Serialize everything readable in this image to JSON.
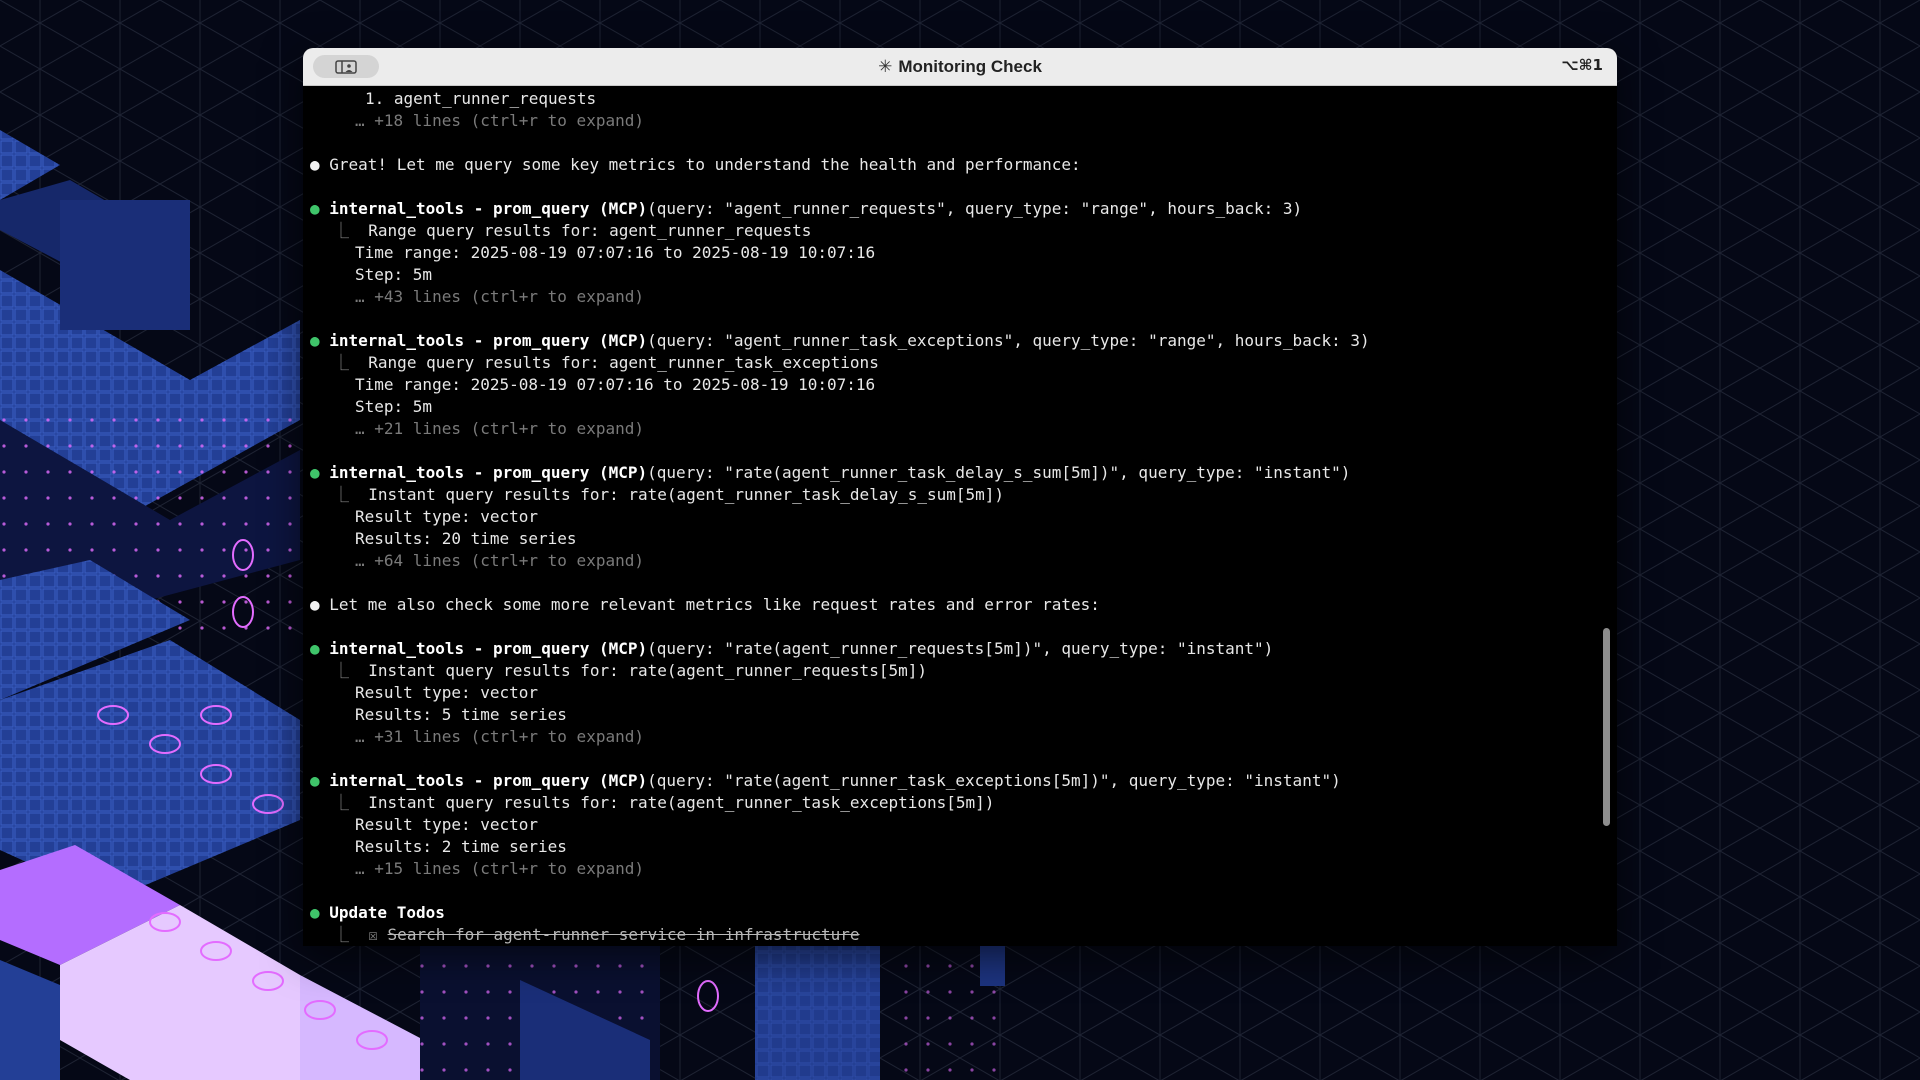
{
  "window": {
    "title": "Monitoring Check",
    "title_icon": "spinner-asterisk",
    "shortcut": "⌥⌘1"
  },
  "lines": [
    {
      "t": "item",
      "text": "1. agent_runner_requests"
    },
    {
      "t": "dim",
      "text": "… +18 lines (ctrl+r to expand)"
    },
    {
      "t": "msg",
      "text": "Great! Let me query some key metrics to understand the health and performance:"
    },
    {
      "t": "tool",
      "name": "internal_tools - prom_query (MCP)",
      "args": "(query: \"agent_runner_requests\", query_type: \"range\", hours_back: 3)"
    },
    {
      "t": "result",
      "text": "Range query results for: agent_runner_requests"
    },
    {
      "t": "out",
      "text": "Time range: 2025-08-19 07:07:16 to 2025-08-19 10:07:16"
    },
    {
      "t": "out",
      "text": "Step: 5m"
    },
    {
      "t": "dim",
      "text": "… +43 lines (ctrl+r to expand)"
    },
    {
      "t": "tool",
      "name": "internal_tools - prom_query (MCP)",
      "args": "(query: \"agent_runner_task_exceptions\", query_type: \"range\", hours_back: 3)"
    },
    {
      "t": "result",
      "text": "Range query results for: agent_runner_task_exceptions"
    },
    {
      "t": "out",
      "text": "Time range: 2025-08-19 07:07:16 to 2025-08-19 10:07:16"
    },
    {
      "t": "out",
      "text": "Step: 5m"
    },
    {
      "t": "dim",
      "text": "… +21 lines (ctrl+r to expand)"
    },
    {
      "t": "tool",
      "name": "internal_tools - prom_query (MCP)",
      "args": "(query: \"rate(agent_runner_task_delay_s_sum[5m])\", query_type: \"instant\")"
    },
    {
      "t": "result",
      "text": "Instant query results for: rate(agent_runner_task_delay_s_sum[5m])"
    },
    {
      "t": "out",
      "text": "Result type: vector"
    },
    {
      "t": "out",
      "text": "Results: 20 time series"
    },
    {
      "t": "dim",
      "text": "… +64 lines (ctrl+r to expand)"
    },
    {
      "t": "msg",
      "text": "Let me also check some more relevant metrics like request rates and error rates:"
    },
    {
      "t": "tool",
      "name": "internal_tools - prom_query (MCP)",
      "args": "(query: \"rate(agent_runner_requests[5m])\", query_type: \"instant\")"
    },
    {
      "t": "result",
      "text": "Instant query results for: rate(agent_runner_requests[5m])"
    },
    {
      "t": "out",
      "text": "Result type: vector"
    },
    {
      "t": "out",
      "text": "Results: 5 time series"
    },
    {
      "t": "dim",
      "text": "… +31 lines (ctrl+r to expand)"
    },
    {
      "t": "tool",
      "name": "internal_tools - prom_query (MCP)",
      "args": "(query: \"rate(agent_runner_task_exceptions[5m])\", query_type: \"instant\")"
    },
    {
      "t": "result",
      "text": "Instant query results for: rate(agent_runner_task_exceptions[5m])"
    },
    {
      "t": "out",
      "text": "Result type: vector"
    },
    {
      "t": "out",
      "text": "Results: 2 time series"
    },
    {
      "t": "dim",
      "text": "… +15 lines (ctrl+r to expand)"
    },
    {
      "t": "todo_head",
      "text": "Update Todos"
    },
    {
      "t": "todo",
      "text": "Search for agent-runner service in infrastructure"
    }
  ],
  "colors": {
    "terminal_bg": "#000000",
    "accent_bullet": "#3fc46a",
    "wallpaper_bg": "#050816",
    "wallpaper_blue": "#1d3480",
    "wallpaper_purple": "#b46dff"
  }
}
